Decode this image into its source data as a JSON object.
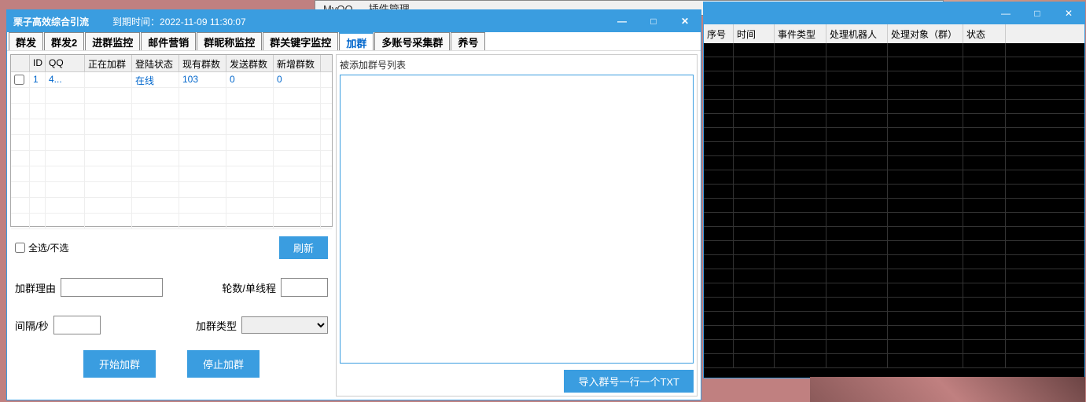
{
  "bg_window": {
    "title": "MyQQ — 插件管理"
  },
  "left_window": {
    "title": "栗子高效综合引流",
    "expire_label": "到期时间：",
    "expire_time": "2022-11-09 11:30:07"
  },
  "tabs": [
    "群发",
    "群发2",
    "进群监控",
    "邮件营销",
    "群昵称监控",
    "群关键字监控",
    "加群",
    "多账号采集群",
    "养号"
  ],
  "active_tab_index": 6,
  "account_table": {
    "headers": [
      "",
      "ID",
      "QQ",
      "正在加群",
      "登陆状态",
      "现有群数",
      "发送群数",
      "新增群数"
    ],
    "rows": [
      {
        "id": "1",
        "qq": "4...",
        "joining": "",
        "status": "在线",
        "existing": "103",
        "sent": "0",
        "new": "0"
      }
    ]
  },
  "select_all_label": "全选/不选",
  "refresh_btn": "刷新",
  "form": {
    "reason_label": "加群理由",
    "rounds_label": "轮数/单线程",
    "interval_label": "间隔/秒",
    "type_label": "加群类型",
    "start_btn": "开始加群",
    "stop_btn": "停止加群"
  },
  "right_panel": {
    "list_label": "被添加群号列表",
    "import_btn": "导入群号一行一个TXT"
  },
  "dark_table": {
    "headers": [
      "序号",
      "时间",
      "事件类型",
      "处理机器人",
      "处理对象（群）",
      "状态"
    ]
  }
}
